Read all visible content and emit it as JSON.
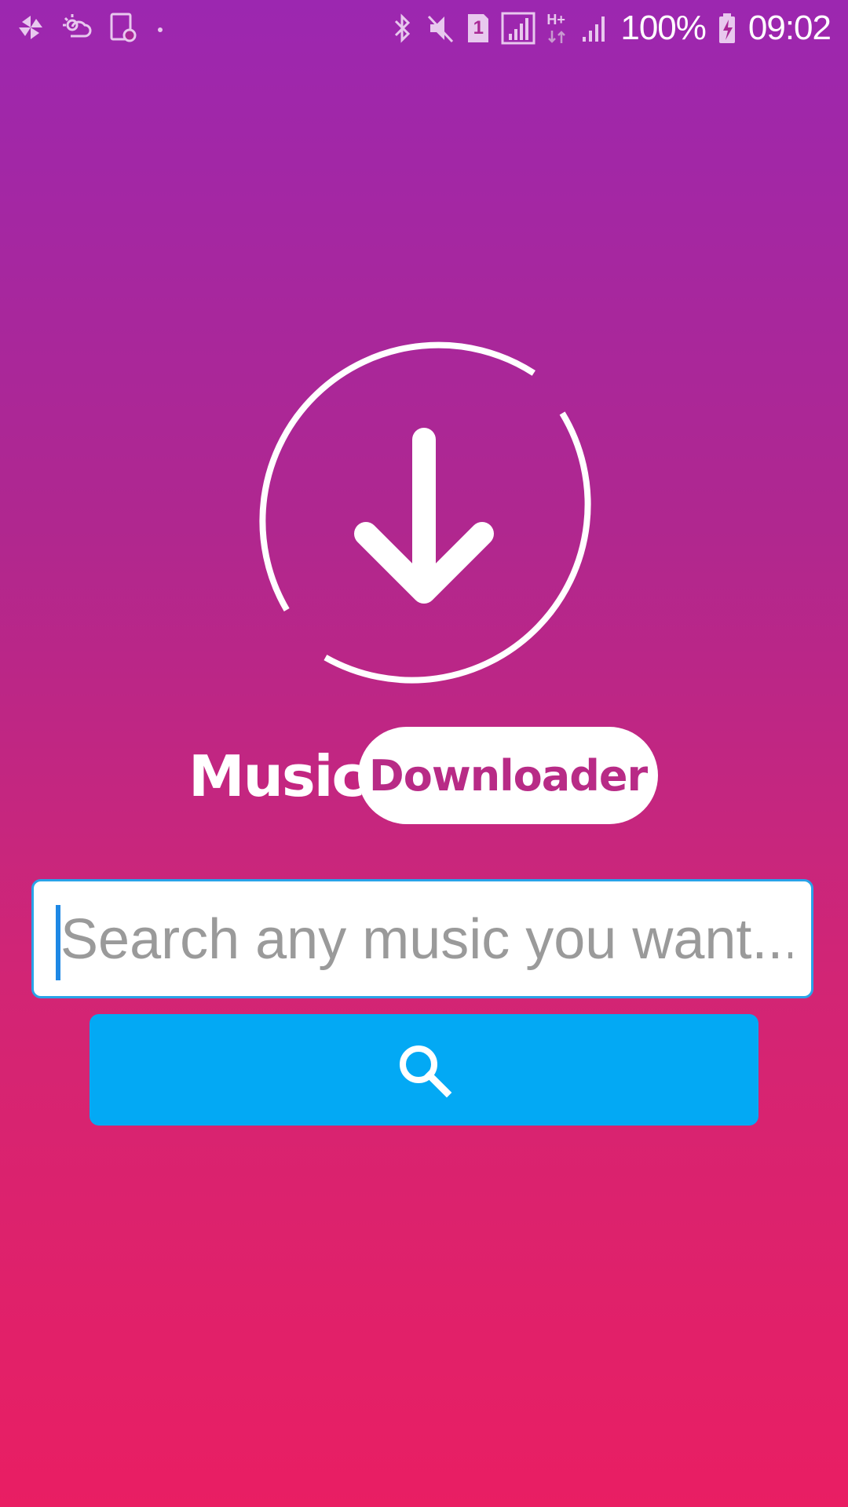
{
  "status_bar": {
    "left_icons": [
      "pinwheel-icon",
      "weather-icon",
      "screenshot-icon",
      "dot-icon"
    ],
    "right_icons": [
      "bluetooth-icon",
      "mute-icon",
      "sim1-icon",
      "signal-icon",
      "network-hplus-icon",
      "signal-icon",
      "battery-charging-icon"
    ],
    "network_type": "H+",
    "sim_number": "1",
    "battery_percent": "100%",
    "time": "09:02"
  },
  "logo": {
    "icon": "download-circle-icon",
    "color": "#ffffff"
  },
  "brand": {
    "word1": "Music",
    "word2": "Downloader",
    "pill_text_color": "#b82b86"
  },
  "search": {
    "placeholder": "Search any music you want...",
    "value": ""
  },
  "search_button": {
    "icon": "search-icon",
    "color": "#03a9f4"
  },
  "theme": {
    "gradient_top": "#9c27b0",
    "gradient_bottom": "#e91e63",
    "input_border": "#29a3e8"
  }
}
